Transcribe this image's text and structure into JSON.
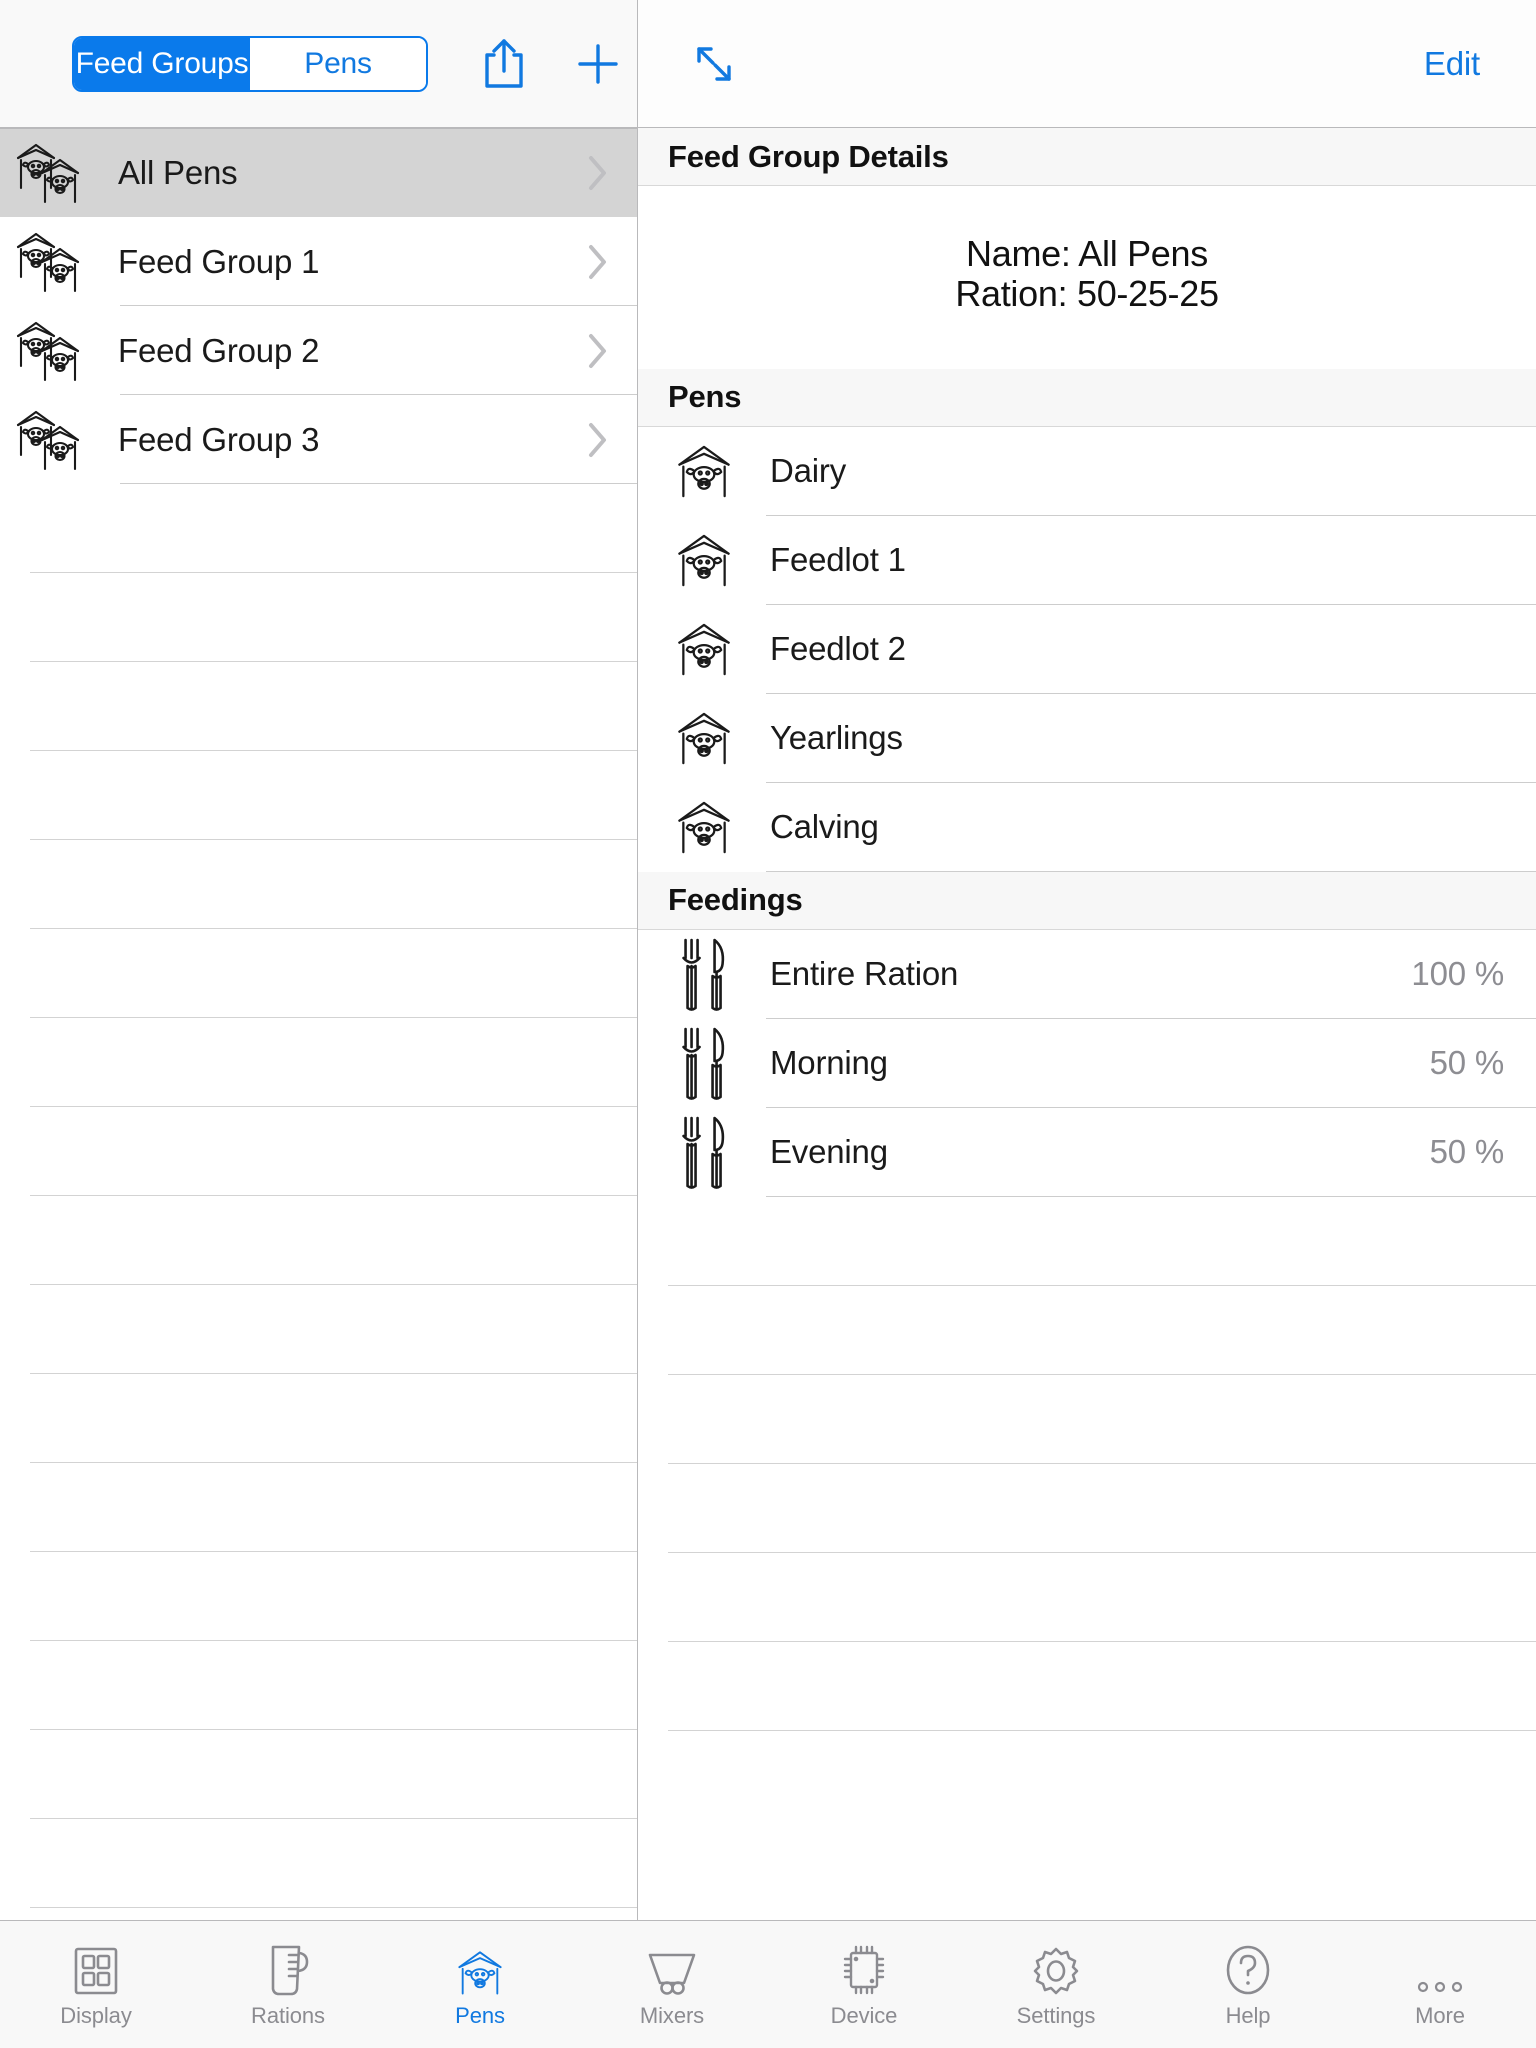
{
  "master": {
    "segmented": {
      "options": [
        {
          "label": "Feed Groups",
          "selected": true
        },
        {
          "label": "Pens",
          "selected": false
        }
      ]
    },
    "toolbar": {
      "share_icon": "share-icon",
      "add_icon": "plus-icon"
    },
    "list": [
      {
        "label": "All Pens",
        "icon": "double-barn-cow-icon",
        "selected": true
      },
      {
        "label": "Feed Group 1",
        "icon": "double-barn-cow-icon",
        "selected": false
      },
      {
        "label": "Feed Group 2",
        "icon": "double-barn-cow-icon",
        "selected": false
      },
      {
        "label": "Feed Group 3",
        "icon": "double-barn-cow-icon",
        "selected": false
      }
    ],
    "empty_row_count": 17
  },
  "detail": {
    "toolbar": {
      "expand_icon": "expand-diagonal-arrows-icon",
      "edit_label": "Edit"
    },
    "details_header": "Feed Group Details",
    "summary": {
      "name_line": "Name: All Pens",
      "ration_line": "Ration: 50-25-25"
    },
    "pens_header": "Pens",
    "pens": [
      {
        "label": "Dairy",
        "icon": "barn-cow-icon"
      },
      {
        "label": "Feedlot 1",
        "icon": "barn-cow-icon"
      },
      {
        "label": "Feedlot 2",
        "icon": "barn-cow-icon"
      },
      {
        "label": "Yearlings",
        "icon": "barn-cow-icon"
      },
      {
        "label": "Calving",
        "icon": "barn-cow-icon"
      }
    ],
    "feedings_header": "Feedings",
    "feedings": [
      {
        "label": "Entire Ration",
        "value": "100 %",
        "icon": "fork-knife-icon"
      },
      {
        "label": "Morning",
        "value": "50 %",
        "icon": "fork-knife-icon"
      },
      {
        "label": "Evening",
        "value": "50 %",
        "icon": "fork-knife-icon"
      }
    ],
    "filler_row_count": 6
  },
  "tabbar": {
    "tabs": [
      {
        "label": "Display",
        "icon": "seven-segment-display-icon",
        "active": false
      },
      {
        "label": "Rations",
        "icon": "measuring-cup-icon",
        "active": false
      },
      {
        "label": "Pens",
        "icon": "barn-cow-icon",
        "active": true
      },
      {
        "label": "Mixers",
        "icon": "mixer-hopper-icon",
        "active": false
      },
      {
        "label": "Device",
        "icon": "chip-icon",
        "active": false
      },
      {
        "label": "Settings",
        "icon": "gear-icon",
        "active": false
      },
      {
        "label": "Help",
        "icon": "question-circle-icon",
        "active": false
      },
      {
        "label": "More",
        "icon": "ellipsis-icon",
        "active": false
      }
    ]
  },
  "colors": {
    "accent": "#1179e0",
    "selected_row": "#d4d4d4",
    "section_header_bg": "#f7f7f7",
    "separator": "#cdcdcd",
    "value_text": "#8d8d92"
  }
}
